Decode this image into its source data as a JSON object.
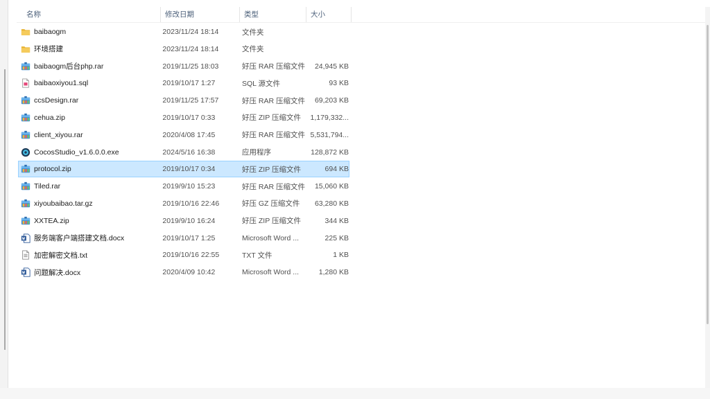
{
  "columns": {
    "name": "名称",
    "date": "修改日期",
    "type": "类型",
    "size": "大小"
  },
  "files": [
    {
      "name": "baibaogm",
      "date": "2023/11/24 18:14",
      "type": "文件夹",
      "size": "",
      "icon": "folder-icon"
    },
    {
      "name": "环境搭建",
      "date": "2023/11/24 18:14",
      "type": "文件夹",
      "size": "",
      "icon": "folder-icon"
    },
    {
      "name": "baibaogm后台php.rar",
      "date": "2019/11/25 18:03",
      "type": "好压 RAR 压缩文件",
      "size": "24,945 KB",
      "icon": "archive-icon"
    },
    {
      "name": "baibaoxiyou1.sql",
      "date": "2019/10/17 1:27",
      "type": "SQL 源文件",
      "size": "93 KB",
      "icon": "sql-file-icon"
    },
    {
      "name": "ccsDesign.rar",
      "date": "2019/11/25 17:57",
      "type": "好压 RAR 压缩文件",
      "size": "69,203 KB",
      "icon": "archive-icon"
    },
    {
      "name": "cehua.zip",
      "date": "2019/10/17 0:33",
      "type": "好压 ZIP 压缩文件",
      "size": "1,179,332...",
      "icon": "archive-icon"
    },
    {
      "name": "client_xiyou.rar",
      "date": "2020/4/08 17:45",
      "type": "好压 RAR 压缩文件",
      "size": "5,531,794...",
      "icon": "archive-icon"
    },
    {
      "name": "CocosStudio_v1.6.0.0.exe",
      "date": "2024/5/16 16:38",
      "type": "应用程序",
      "size": "128,872 KB",
      "icon": "exe-icon"
    },
    {
      "name": "protocol.zip",
      "date": "2019/10/17 0:34",
      "type": "好压 ZIP 压缩文件",
      "size": "694 KB",
      "icon": "archive-icon",
      "selected": true
    },
    {
      "name": "Tiled.rar",
      "date": "2019/9/10 15:23",
      "type": "好压 RAR 压缩文件",
      "size": "15,060 KB",
      "icon": "archive-icon"
    },
    {
      "name": "xiyoubaibao.tar.gz",
      "date": "2019/10/16 22:46",
      "type": "好压 GZ 压缩文件",
      "size": "63,280 KB",
      "icon": "archive-icon"
    },
    {
      "name": "XXTEA.zip",
      "date": "2019/9/10 16:24",
      "type": "好压 ZIP 压缩文件",
      "size": "344 KB",
      "icon": "archive-icon"
    },
    {
      "name": "服务端客户端搭建文档.docx",
      "date": "2019/10/17 1:25",
      "type": "Microsoft Word ...",
      "size": "225 KB",
      "icon": "word-doc-icon"
    },
    {
      "name": "加密解密文档.txt",
      "date": "2019/10/16 22:55",
      "type": "TXT 文件",
      "size": "1 KB",
      "icon": "text-file-icon"
    },
    {
      "name": "问题解决.docx",
      "date": "2020/4/09 10:42",
      "type": "Microsoft Word ...",
      "size": "1,280 KB",
      "icon": "word-doc-icon"
    }
  ],
  "colors": {
    "selected_bg": "#cce8ff",
    "selected_border": "#99d1ff",
    "header_text": "#4c607a",
    "folder": "#f0c24b"
  }
}
